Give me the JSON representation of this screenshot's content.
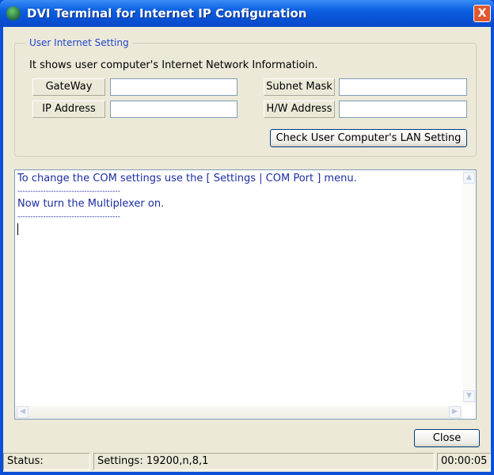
{
  "window": {
    "title": "DVI Terminal for Internet IP Configuration",
    "close_glyph": "X"
  },
  "group": {
    "legend": "User Internet Setting",
    "info": "It shows user computer's Internet Network Informatioin.",
    "gateway_label": "GateWay",
    "gateway_value": "",
    "ip_label": "IP Address",
    "ip_value": "",
    "subnet_label": "Subnet Mask",
    "subnet_value": "",
    "hw_label": "H/W Address",
    "hw_value": "",
    "check_button": "Check User Computer's LAN Setting"
  },
  "terminal": {
    "lines": [
      "To change the COM settings use the [ Settings | COM Port ] menu.",
      "",
      "----------------------------------------",
      "Now turn the Multiplexer on.",
      "----------------------------------------"
    ]
  },
  "close_button": "Close",
  "statusbar": {
    "status": "Status:",
    "settings": "Settings: 19200,n,8,1",
    "time": "00:00:05"
  }
}
